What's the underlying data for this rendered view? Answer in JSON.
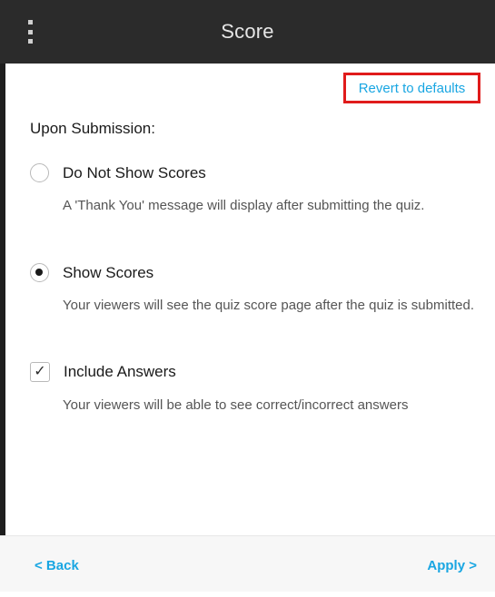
{
  "header": {
    "title": "Score",
    "menu_icon": "kebab-menu-icon"
  },
  "actions": {
    "revert_label": "Revert to defaults",
    "highlight_color": "#e01b1b",
    "link_color": "#19a6e2"
  },
  "section": {
    "title": "Upon Submission:"
  },
  "options": [
    {
      "type": "radio",
      "label": "Do Not Show Scores",
      "checked": false,
      "description": "A 'Thank You' message will display after submitting the quiz."
    },
    {
      "type": "radio",
      "label": "Show Scores",
      "checked": true,
      "description": "Your viewers will see the quiz score page after the quiz is submitted."
    },
    {
      "type": "checkbox",
      "label": "Include Answers",
      "checked": true,
      "description": "Your viewers will be able to see correct/incorrect answers"
    }
  ],
  "footer": {
    "back_label": "< Back",
    "apply_label": "Apply >"
  }
}
